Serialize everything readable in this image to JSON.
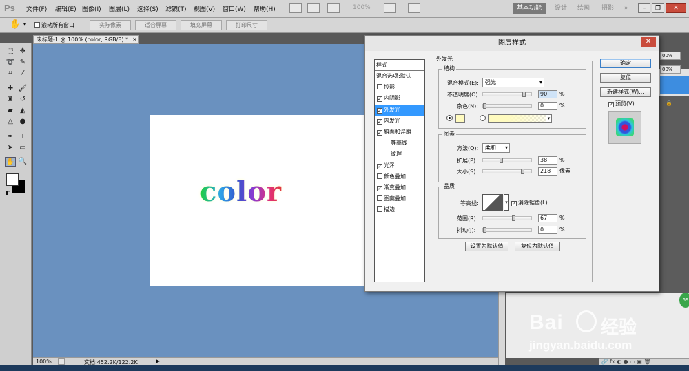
{
  "app": {
    "logo": "Ps",
    "menu": [
      "文件(F)",
      "编辑(E)",
      "图像(I)",
      "图层(L)",
      "选择(S)",
      "滤镜(T)",
      "视图(V)",
      "窗口(W)",
      "帮助(H)"
    ],
    "zoom_menu": "100%",
    "workspaces": [
      "基本功能",
      "设计",
      "绘画",
      "摄影"
    ],
    "workspace_more": "»"
  },
  "options_bar": {
    "scroll_all_label": "滚动所有窗口",
    "buttons": [
      "实际像素",
      "适合屏幕",
      "填充屏幕",
      "打印尺寸"
    ]
  },
  "document": {
    "tab_title": "未标题-1 @ 100% (color, RGB/8) *",
    "canvas_text": "color",
    "zoom": "100%",
    "doc_info": "文档:452.2K/122.2K"
  },
  "right_panels": {
    "pct_values": [
      "00%",
      "00%"
    ],
    "badge": "69"
  },
  "dialog": {
    "title": "图层样式",
    "close": "✕",
    "list_header": "样式",
    "list": [
      {
        "label": "混合选项:默认",
        "checkbox": false,
        "checked": false,
        "selected": false,
        "sub": false
      },
      {
        "label": "投影",
        "checkbox": true,
        "checked": false,
        "selected": false,
        "sub": false
      },
      {
        "label": "内阴影",
        "checkbox": true,
        "checked": true,
        "selected": false,
        "sub": false
      },
      {
        "label": "外发光",
        "checkbox": true,
        "checked": true,
        "selected": true,
        "sub": false
      },
      {
        "label": "内发光",
        "checkbox": true,
        "checked": true,
        "selected": false,
        "sub": false
      },
      {
        "label": "斜面和浮雕",
        "checkbox": true,
        "checked": true,
        "selected": false,
        "sub": false
      },
      {
        "label": "等高线",
        "checkbox": true,
        "checked": false,
        "selected": false,
        "sub": true
      },
      {
        "label": "纹理",
        "checkbox": true,
        "checked": false,
        "selected": false,
        "sub": true
      },
      {
        "label": "光泽",
        "checkbox": true,
        "checked": true,
        "selected": false,
        "sub": false
      },
      {
        "label": "颜色叠加",
        "checkbox": true,
        "checked": false,
        "selected": false,
        "sub": false
      },
      {
        "label": "渐变叠加",
        "checkbox": true,
        "checked": true,
        "selected": false,
        "sub": false
      },
      {
        "label": "图案叠加",
        "checkbox": true,
        "checked": false,
        "selected": false,
        "sub": false
      },
      {
        "label": "描边",
        "checkbox": true,
        "checked": false,
        "selected": false,
        "sub": false
      }
    ],
    "section_title": "外发光",
    "structure": {
      "title": "结构",
      "blend_mode_label": "混合模式(E):",
      "blend_mode_value": "强光",
      "opacity_label": "不透明度(O):",
      "opacity_value": "90",
      "opacity_level": 90,
      "noise_label": "杂色(N):",
      "noise_value": "0",
      "noise_level": 0,
      "percent": "%",
      "glow_color": "#fffbbf"
    },
    "elements": {
      "title": "图素",
      "method_label": "方法(Q):",
      "method_value": "柔和",
      "spread_label": "扩展(P):",
      "spread_value": "38",
      "spread_level": 38,
      "size_label": "大小(S):",
      "size_value": "218",
      "size_level": 87,
      "percent": "%",
      "px_unit": "像素"
    },
    "quality": {
      "title": "品质",
      "contour_label": "等高线:",
      "antialias_label": "消除锯齿(L)",
      "range_label": "范围(R):",
      "range_value": "67",
      "range_level": 67,
      "jitter_label": "抖动(J):",
      "jitter_value": "0",
      "jitter_level": 0,
      "percent": "%"
    },
    "set_default": "设置为默认值",
    "reset_default": "复位为默认值",
    "ok": "确定",
    "reset": "复位",
    "new_style": "新建样式(W)...",
    "preview_label": "预览(V)"
  },
  "watermark": {
    "brand": "Bai",
    "brand2": "经验",
    "url": "jingyan.baidu.com"
  }
}
